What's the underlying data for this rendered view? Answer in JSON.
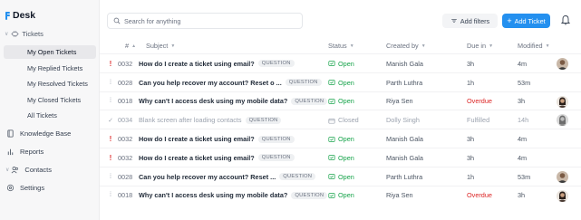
{
  "app": {
    "name": "Desk",
    "accent": "#2490ef"
  },
  "sidebar": {
    "group": {
      "label": "Tickets",
      "icon": "ticket-icon"
    },
    "items": [
      {
        "label": "My Open Tickets",
        "active": true
      },
      {
        "label": "My Replied Tickets",
        "active": false
      },
      {
        "label": "My Resolved Tickets",
        "active": false
      },
      {
        "label": "My Closed Tickets",
        "active": false
      },
      {
        "label": "All Tickets",
        "active": false
      }
    ],
    "main": [
      {
        "label": "Knowledge Base",
        "icon": "book-icon"
      },
      {
        "label": "Reports",
        "icon": "bar-chart-icon"
      },
      {
        "label": "Contacts",
        "icon": "contacts-icon"
      },
      {
        "label": "Settings",
        "icon": "gear-icon"
      }
    ]
  },
  "search": {
    "placeholder": "Search for anything",
    "value": ""
  },
  "toolbar": {
    "filters_label": "Add filters",
    "add_label": "Add Ticket"
  },
  "table": {
    "columns": {
      "id": "#",
      "subject": "Subject",
      "status": "Status",
      "created_by": "Created by",
      "due_in": "Due in",
      "modified": "Modified"
    },
    "rows": [
      {
        "priority": "!",
        "priority_level": "urgent",
        "id": "0032",
        "subject": "How do I create a ticket using email?",
        "tag": "QUESTION",
        "status": "Open",
        "created_by": "Manish Gala",
        "due_in": "3h",
        "overdue": false,
        "modified": "4m",
        "avatar": "man"
      },
      {
        "priority": "⁞",
        "priority_level": "low",
        "id": "0028",
        "subject": "Can you help recover my account? Reset o ...",
        "tag": "QUESTION",
        "status": "Open",
        "created_by": "Parth Luthra",
        "due_in": "1h",
        "overdue": false,
        "modified": "53m",
        "avatar": ""
      },
      {
        "priority": "⁞",
        "priority_level": "low",
        "id": "0018",
        "subject": "Why can't I access desk using my mobile data?",
        "tag": "QUESTION",
        "status": "Open",
        "created_by": "Riya Sen",
        "due_in": "Overdue",
        "overdue": true,
        "modified": "3h",
        "avatar": "woman"
      },
      {
        "priority": "✓",
        "priority_level": "low",
        "id": "0034",
        "subject": "Blank screen after loading contacts",
        "tag": "QUESTION",
        "status": "Closed",
        "created_by": "Dolly Singh",
        "due_in": "Fulfilled",
        "overdue": false,
        "modified": "14h",
        "avatar": "woman2"
      },
      {
        "priority": "!",
        "priority_level": "urgent",
        "id": "0032",
        "subject": "How do I create a ticket using email?",
        "tag": "QUESTION",
        "status": "Open",
        "created_by": "Manish Gala",
        "due_in": "3h",
        "overdue": false,
        "modified": "4m",
        "avatar": ""
      },
      {
        "priority": "!",
        "priority_level": "urgent",
        "id": "0032",
        "subject": "How do I create a ticket using email?",
        "tag": "QUESTION",
        "status": "Open",
        "created_by": "Manish Gala",
        "due_in": "3h",
        "overdue": false,
        "modified": "4m",
        "avatar": ""
      },
      {
        "priority": "⁞",
        "priority_level": "low",
        "id": "0028",
        "subject": "Can you help recover my account? Reset ...",
        "tag": "QUESTION",
        "status": "Open",
        "created_by": "Parth Luthra",
        "due_in": "1h",
        "overdue": false,
        "modified": "53m",
        "avatar": "man"
      },
      {
        "priority": "⁞",
        "priority_level": "low",
        "id": "0018",
        "subject": "Why can't I access desk using my mobile data?",
        "tag": "QUESTION",
        "status": "Open",
        "created_by": "Riya Sen",
        "due_in": "Overdue",
        "overdue": true,
        "modified": "3h",
        "avatar": "woman"
      }
    ]
  }
}
